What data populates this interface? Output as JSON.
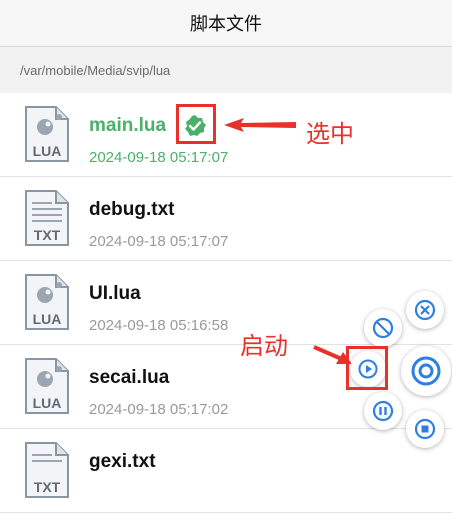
{
  "header": {
    "title": "脚本文件"
  },
  "path": "/var/mobile/Media/svip/lua",
  "files": [
    {
      "name": "main.lua",
      "date": "2024-09-18 05:17:07",
      "ext": "LUA",
      "selected": true
    },
    {
      "name": "debug.txt",
      "date": "2024-09-18 05:17:07",
      "ext": "TXT",
      "selected": false
    },
    {
      "name": "UI.lua",
      "date": "2024-09-18 05:16:58",
      "ext": "LUA",
      "selected": false
    },
    {
      "name": "secai.lua",
      "date": "2024-09-18 05:17:02",
      "ext": "LUA",
      "selected": false
    },
    {
      "name": "gexi.txt",
      "date": "",
      "ext": "TXT",
      "selected": false
    }
  ],
  "annotations": {
    "select_label": "选中",
    "start_label": "启动"
  },
  "colors": {
    "selected_green": "#4caf6a",
    "accent_blue": "#2f7fe0",
    "annotation_red": "#e8312a"
  },
  "fab_icons": [
    "stop-circle-icon",
    "close-circle-icon",
    "target-icon",
    "play-icon",
    "pause-icon",
    "square-stop-icon"
  ]
}
